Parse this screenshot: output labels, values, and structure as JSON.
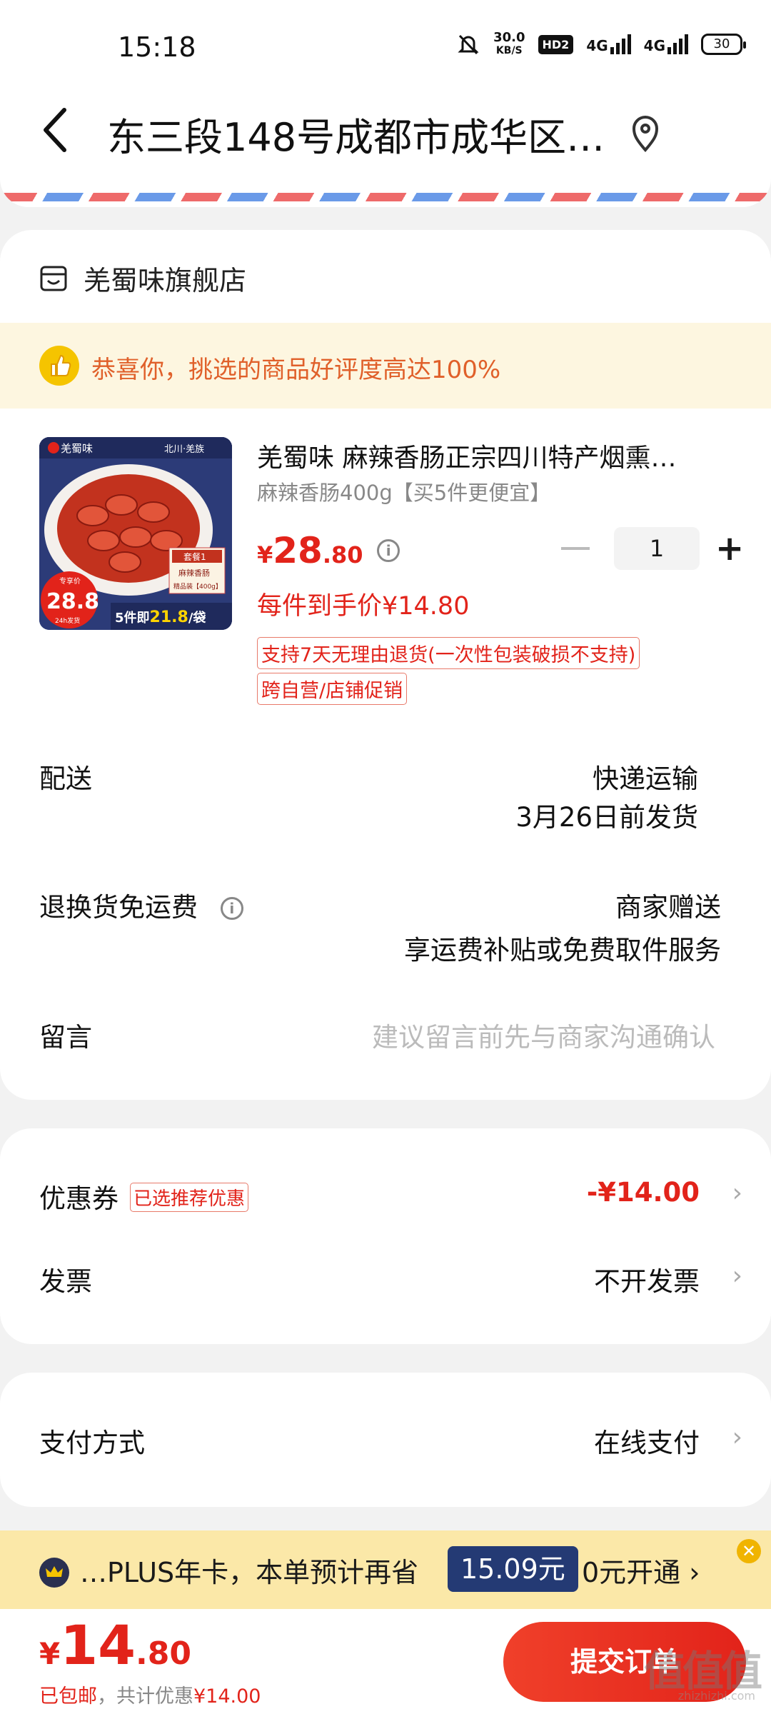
{
  "status_bar": {
    "time": "15:18",
    "speed_value": "30.0",
    "speed_unit": "KB/S",
    "hd": "HD2",
    "signal1": "4G",
    "signal2": "4G",
    "battery": "30"
  },
  "header": {
    "address": "东三段148号成都市成华区…"
  },
  "shop": {
    "name": "羌蜀味旗舰店",
    "banner": "恭喜你，挑选的商品好评度高达100%",
    "product": {
      "title": "羌蜀味 麻辣香肠正宗四川特产烟熏…",
      "spec": "麻辣香肠400g【买5件更便宜】",
      "price_symbol": "¥",
      "price_int": "28",
      "price_dec": ".80",
      "unit_price": "每件到手价¥14.80",
      "tag1": "支持7天无理由退货(一次性包装破损不支持)",
      "tag2": "跨自营/店铺促销",
      "quantity": "1",
      "image": {
        "brand": "羌蜀味",
        "origin": "北川·羌族",
        "badge_top": "专享价",
        "badge_price": "28.8",
        "badge_sub": "24h发货",
        "promo_prefix": "5件即",
        "promo_price": "21.8",
        "promo_suffix": "/袋",
        "set_label": "套餐1",
        "set_item": "麻辣香肠",
        "set_weight": "精品装【400g】"
      }
    },
    "delivery_label": "配送",
    "delivery_method": "快递运输",
    "delivery_date": "3月26日前发货",
    "return_label": "退换货免运费",
    "return_value1": "商家赠送",
    "return_value2": "享运费补贴或免费取件服务",
    "message_label": "留言",
    "message_placeholder": "建议留言前先与商家沟通确认"
  },
  "coupon": {
    "label": "优惠券",
    "badge": "已选推荐优惠",
    "value": "-¥14.00",
    "invoice_label": "发票",
    "invoice_value": "不开发票"
  },
  "payment": {
    "label": "支付方式",
    "value": "在线支付"
  },
  "plus": {
    "text": "…PLUS年卡，本单预计再省",
    "amount": "15.09元",
    "open": "0元开通 ›"
  },
  "footer": {
    "total_symbol": "¥",
    "total_int": "14",
    "total_dec": ".80",
    "shipping": "已包邮",
    "discount_text": "，共计优惠",
    "discount_value": "¥14.00",
    "submit": "提交订单",
    "watermark": "值值值",
    "watermark_sub": "zhizhizhi.com"
  },
  "colors": {
    "accent": "#e2231a",
    "banner_bg": "#fdf6e0",
    "plus_bg": "#fbe8a8",
    "plus_amount_bg": "#243a74"
  }
}
